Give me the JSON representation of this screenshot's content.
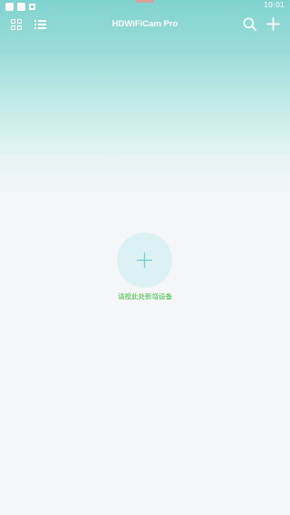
{
  "status_bar": {
    "time": "10:01",
    "icons": [
      "notification-square-icon",
      "notification-square-icon",
      "notification-small-icon"
    ]
  },
  "app_bar": {
    "title": "HDWiFiCam Pro",
    "left_icons": [
      "grid-view-icon",
      "list-view-icon"
    ],
    "right_icons": [
      "search-icon",
      "add-icon"
    ]
  },
  "empty_state": {
    "icon": "plus-icon",
    "label": "请按此处新增设备"
  },
  "colors": {
    "header_gradient_top": "#7fd3cf",
    "background": "#f4f6f8",
    "add_circle": "#dcf1f3",
    "accent_plus": "#6fcfd0",
    "label_green": "#3ebc3e"
  }
}
